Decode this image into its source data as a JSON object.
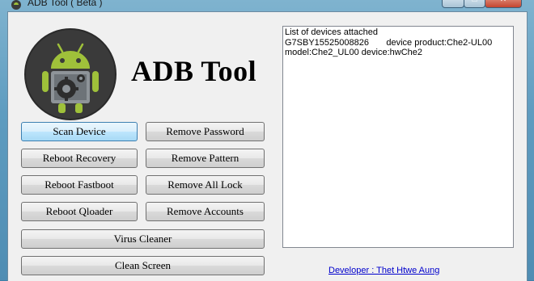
{
  "window": {
    "title": "ADB Tool ( Beta )"
  },
  "header": {
    "app_title": "ADB Tool"
  },
  "buttons": {
    "scan_device": "Scan Device",
    "remove_password": "Remove Password",
    "reboot_recovery": "Reboot Recovery",
    "remove_pattern": "Remove Pattern",
    "reboot_fastboot": "Reboot Fastboot",
    "remove_all_lock": "Remove All Lock",
    "reboot_qloader": "Reboot Qloader",
    "remove_accounts": "Remove Accounts",
    "virus_cleaner": "Virus Cleaner",
    "clean_screen": "Clean Screen"
  },
  "log": {
    "lines": [
      "List of devices attached",
      "G7SBY15525008826       device product:Che2-UL00",
      "model:Che2_UL00 device:hwChe2"
    ]
  },
  "footer": {
    "developer_link": "Developer : Thet Htwe Aung"
  },
  "icons": {
    "app": "android-robot-icon",
    "logo": "android-robot-gear-logo"
  },
  "colors": {
    "desktop": "#3d7fa8",
    "client_bg": "#f0f0f0",
    "link": "#0000cc"
  }
}
